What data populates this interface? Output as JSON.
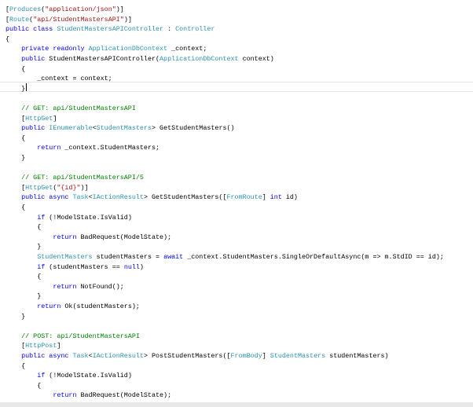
{
  "editor": {
    "colors": {
      "keyword": "#0000ff",
      "type": "#2b91af",
      "string": "#a31515",
      "comment": "#008000"
    },
    "current_line": 9,
    "lines": [
      [
        [
          "[",
          "pl"
        ],
        [
          "Produces",
          "ty"
        ],
        [
          "(",
          "pl"
        ],
        [
          "\"application/json\"",
          "st"
        ],
        [
          ")]",
          "pl"
        ]
      ],
      [
        [
          "[",
          "pl"
        ],
        [
          "Route",
          "ty"
        ],
        [
          "(",
          "pl"
        ],
        [
          "\"api/StudentMastersAPI\"",
          "st"
        ],
        [
          ")]",
          "pl"
        ]
      ],
      [
        [
          "public class ",
          "kw"
        ],
        [
          "StudentMastersAPIController",
          "ty"
        ],
        [
          " : ",
          "pl"
        ],
        [
          "Controller",
          "ty"
        ]
      ],
      [
        [
          "{",
          "pl"
        ]
      ],
      [
        [
          "    ",
          "pl"
        ],
        [
          "private readonly ",
          "kw"
        ],
        [
          "ApplicationDbContext",
          "ty"
        ],
        [
          " _context;",
          "pl"
        ]
      ],
      [
        [
          "    ",
          "pl"
        ],
        [
          "public ",
          "kw"
        ],
        [
          "StudentMastersAPIController(",
          "pl"
        ],
        [
          "ApplicationDbContext",
          "ty"
        ],
        [
          " context)",
          "pl"
        ]
      ],
      [
        [
          "    {",
          "pl"
        ]
      ],
      [
        [
          "        _context = context;",
          "pl"
        ]
      ],
      [
        [
          "    }",
          "pl"
        ]
      ],
      [],
      [
        [
          "    ",
          "pl"
        ],
        [
          "// GET: api/StudentMastersAPI",
          "cm"
        ]
      ],
      [
        [
          "    [",
          "pl"
        ],
        [
          "HttpGet",
          "ty"
        ],
        [
          "]",
          "pl"
        ]
      ],
      [
        [
          "    ",
          "pl"
        ],
        [
          "public ",
          "kw"
        ],
        [
          "IEnumerable",
          "ty"
        ],
        [
          "<",
          "pl"
        ],
        [
          "StudentMasters",
          "ty"
        ],
        [
          "> GetStudentMasters()",
          "pl"
        ]
      ],
      [
        [
          "    {",
          "pl"
        ]
      ],
      [
        [
          "        ",
          "pl"
        ],
        [
          "return",
          "kw"
        ],
        [
          " _context.StudentMasters;",
          "pl"
        ]
      ],
      [
        [
          "    }",
          "pl"
        ]
      ],
      [],
      [
        [
          "    ",
          "pl"
        ],
        [
          "// GET: api/StudentMastersAPI/5",
          "cm"
        ]
      ],
      [
        [
          "    [",
          "pl"
        ],
        [
          "HttpGet",
          "ty"
        ],
        [
          "(",
          "pl"
        ],
        [
          "\"{id}\"",
          "st"
        ],
        [
          ")]",
          "pl"
        ]
      ],
      [
        [
          "    ",
          "pl"
        ],
        [
          "public async ",
          "kw"
        ],
        [
          "Task",
          "ty"
        ],
        [
          "<",
          "pl"
        ],
        [
          "IActionResult",
          "ty"
        ],
        [
          "> GetStudentMasters([",
          "pl"
        ],
        [
          "FromRoute",
          "ty"
        ],
        [
          "] ",
          "pl"
        ],
        [
          "int",
          "kw"
        ],
        [
          " id)",
          "pl"
        ]
      ],
      [
        [
          "    {",
          "pl"
        ]
      ],
      [
        [
          "        ",
          "pl"
        ],
        [
          "if",
          "kw"
        ],
        [
          " (!ModelState.IsValid)",
          "pl"
        ]
      ],
      [
        [
          "        {",
          "pl"
        ]
      ],
      [
        [
          "            ",
          "pl"
        ],
        [
          "return",
          "kw"
        ],
        [
          " BadRequest(ModelState);",
          "pl"
        ]
      ],
      [
        [
          "        }",
          "pl"
        ]
      ],
      [
        [
          "        ",
          "pl"
        ],
        [
          "StudentMasters",
          "ty"
        ],
        [
          " studentMasters = ",
          "pl"
        ],
        [
          "await",
          "kw"
        ],
        [
          " _context.StudentMasters.SingleOrDefaultAsync(m => m.StdID == id);",
          "pl"
        ]
      ],
      [
        [
          "        ",
          "pl"
        ],
        [
          "if",
          "kw"
        ],
        [
          " (studentMasters == ",
          "pl"
        ],
        [
          "null",
          "kw"
        ],
        [
          ")",
          "pl"
        ]
      ],
      [
        [
          "        {",
          "pl"
        ]
      ],
      [
        [
          "            ",
          "pl"
        ],
        [
          "return",
          "kw"
        ],
        [
          " NotFound();",
          "pl"
        ]
      ],
      [
        [
          "        }",
          "pl"
        ]
      ],
      [
        [
          "        ",
          "pl"
        ],
        [
          "return",
          "kw"
        ],
        [
          " Ok(studentMasters);",
          "pl"
        ]
      ],
      [
        [
          "    }",
          "pl"
        ]
      ],
      [],
      [
        [
          "    ",
          "pl"
        ],
        [
          "// POST: api/StudentMastersAPI",
          "cm"
        ]
      ],
      [
        [
          "    [",
          "pl"
        ],
        [
          "HttpPost",
          "ty"
        ],
        [
          "]",
          "pl"
        ]
      ],
      [
        [
          "    ",
          "pl"
        ],
        [
          "public async ",
          "kw"
        ],
        [
          "Task",
          "ty"
        ],
        [
          "<",
          "pl"
        ],
        [
          "IActionResult",
          "ty"
        ],
        [
          "> PostStudentMasters([",
          "pl"
        ],
        [
          "FromBody",
          "ty"
        ],
        [
          "] ",
          "pl"
        ],
        [
          "StudentMasters",
          "ty"
        ],
        [
          " studentMasters)",
          "pl"
        ]
      ],
      [
        [
          "    {",
          "pl"
        ]
      ],
      [
        [
          "        ",
          "pl"
        ],
        [
          "if",
          "kw"
        ],
        [
          " (!ModelState.IsValid)",
          "pl"
        ]
      ],
      [
        [
          "        {",
          "pl"
        ]
      ],
      [
        [
          "            ",
          "pl"
        ],
        [
          "return",
          "kw"
        ],
        [
          " BadRequest(ModelState);",
          "pl"
        ]
      ],
      [
        [
          "        }",
          "pl"
        ]
      ]
    ]
  }
}
